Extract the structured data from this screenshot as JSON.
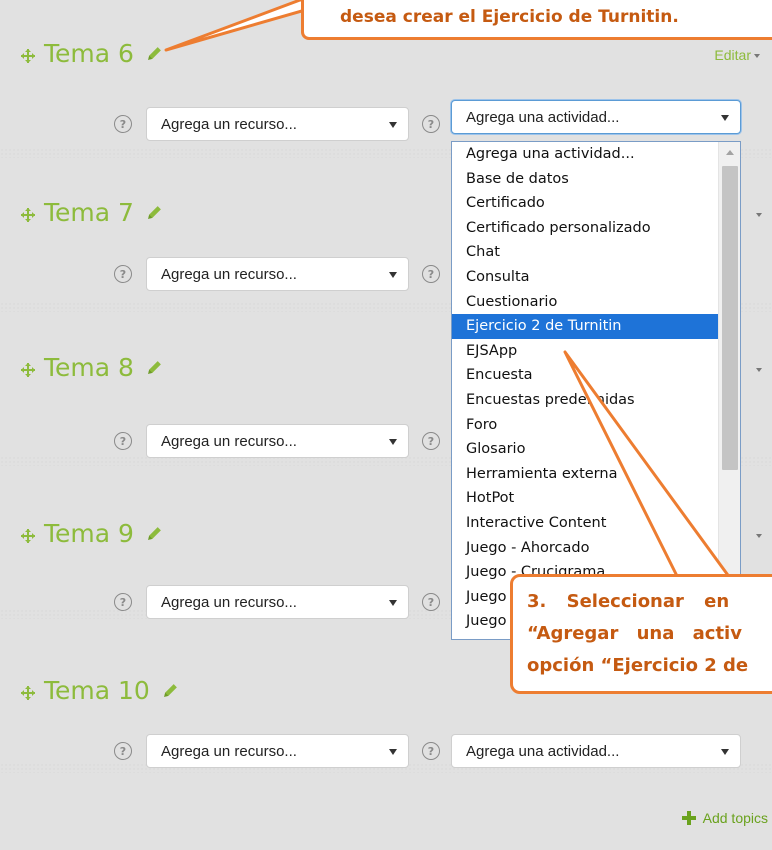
{
  "sections": [
    {
      "title": "Tema 6"
    },
    {
      "title": "Tema 7"
    },
    {
      "title": "Tema 8"
    },
    {
      "title": "Tema 9"
    },
    {
      "title": "Tema 10"
    }
  ],
  "edit_label": "Editar",
  "resource_select": {
    "value": "Agrega un recurso..."
  },
  "activity_select": {
    "value": "Agrega una actividad..."
  },
  "help_glyph": "?",
  "dropdown": {
    "options": [
      "Agrega una actividad...",
      "Base de datos",
      "Certificado",
      "Certificado personalizado",
      "Chat",
      "Consulta",
      "Cuestionario",
      "Ejercicio 2 de Turnitin",
      "EJSApp",
      "Encuesta",
      "Encuestas predefinidas",
      "Foro",
      "Glosario",
      "Herramienta externa",
      "HotPot",
      "Interactive Content",
      "Juego - Ahorcado",
      "Juego - Crucigrama",
      "Juego - Criptograma",
      "Juego - Millonario"
    ],
    "selected": "Ejercicio 2 de Turnitin"
  },
  "callout_top": {
    "text": "desea crear el Ejercicio de Turnitin."
  },
  "callout_bottom": {
    "line1": "3. Seleccionar en",
    "line2": "“Agregar una activ",
    "line3": "opción “Ejercicio 2 de"
  },
  "add_topics": {
    "label": "Add topics"
  },
  "colors": {
    "accent": "#8dbb3c",
    "callout_border": "#ed7d31",
    "callout_text": "#c55a11",
    "selection": "#1e73d8"
  }
}
